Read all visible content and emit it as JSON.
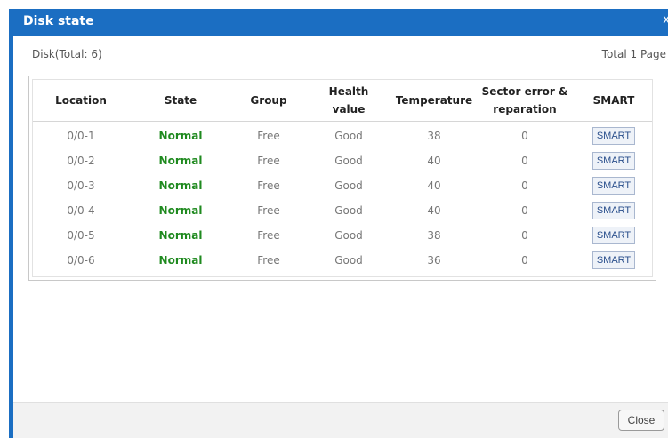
{
  "dialog": {
    "title": "Disk state",
    "close_glyph": "x",
    "disk_total": "Disk(Total: 6)",
    "total_page": "Total 1 Page",
    "close_button": "Close"
  },
  "table": {
    "headers": {
      "location": "Location",
      "state": "State",
      "group": "Group",
      "health_line1": "Health",
      "health_line2": "value",
      "temperature": "Temperature",
      "sector_line1": "Sector error &",
      "sector_line2": "reparation",
      "smart": "SMART"
    },
    "rows": [
      {
        "location": "0/0-1",
        "state": "Normal",
        "group": "Free",
        "health": "Good",
        "temperature": "38",
        "sector": "0",
        "smart": "SMART"
      },
      {
        "location": "0/0-2",
        "state": "Normal",
        "group": "Free",
        "health": "Good",
        "temperature": "40",
        "sector": "0",
        "smart": "SMART"
      },
      {
        "location": "0/0-3",
        "state": "Normal",
        "group": "Free",
        "health": "Good",
        "temperature": "40",
        "sector": "0",
        "smart": "SMART"
      },
      {
        "location": "0/0-4",
        "state": "Normal",
        "group": "Free",
        "health": "Good",
        "temperature": "40",
        "sector": "0",
        "smart": "SMART"
      },
      {
        "location": "0/0-5",
        "state": "Normal",
        "group": "Free",
        "health": "Good",
        "temperature": "38",
        "sector": "0",
        "smart": "SMART"
      },
      {
        "location": "0/0-6",
        "state": "Normal",
        "group": "Free",
        "health": "Good",
        "temperature": "36",
        "sector": "0",
        "smart": "SMART"
      }
    ]
  },
  "colors": {
    "titlebar": "#1b6ec2",
    "state_normal": "#1f8a1f"
  }
}
